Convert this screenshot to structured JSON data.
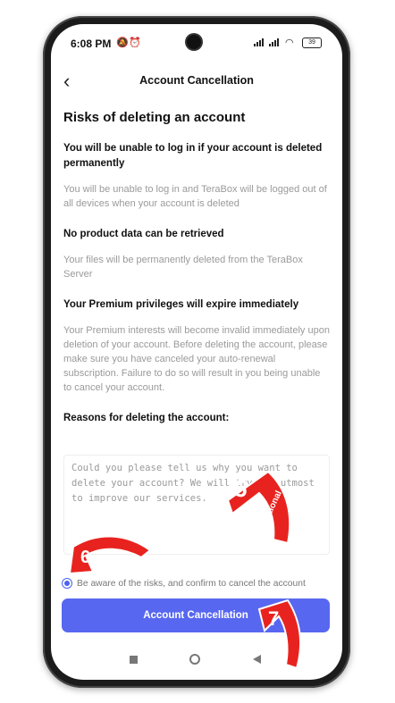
{
  "status": {
    "time": "6:08 PM",
    "battery": "39"
  },
  "header": {
    "back_label": "‹",
    "title": "Account Cancellation"
  },
  "page": {
    "heading": "Risks of deleting an account"
  },
  "sections": [
    {
      "title": "You will be unable to log in if your account is deleted permanently",
      "body": "You will be unable to log in and TeraBox will be logged out of all devices when your account is deleted"
    },
    {
      "title": "No product data can be retrieved",
      "body": "Your files will be permanently deleted from the TeraBox Server"
    },
    {
      "title": "Your Premium privileges will expire immediately",
      "body": "Your Premium interests will become invalid immediately upon deletion of your account. Before deleting the account, please make sure you have canceled your auto-renewal subscription. Failure to do so will result in you being unable to cancel your account."
    }
  ],
  "reasons": {
    "label": "Reasons for deleting the account:",
    "placeholder": "Could you please tell us why you want to delete your account? We will try our utmost to improve our services."
  },
  "confirm": {
    "label": "Be aware of the risks, and confirm to cancel the account",
    "checked": true
  },
  "actions": {
    "cancel_button": "Account Cancellation"
  },
  "annotations": {
    "step5": "5",
    "step5_note": "Optional",
    "step6": "6",
    "step7": "7",
    "color": "#e8231f"
  },
  "colors": {
    "accent": "#5867f0"
  }
}
